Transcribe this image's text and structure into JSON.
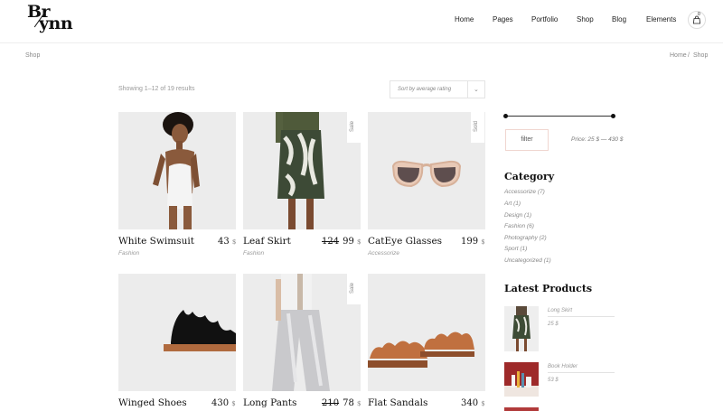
{
  "header": {
    "logo_line1": "Br",
    "logo_line2": "ynn",
    "nav": [
      "Home",
      "Pages",
      "Portfolio",
      "Shop",
      "Blog",
      "Elements"
    ],
    "cart_count": "0"
  },
  "breadcrumb": {
    "page_title": "Shop",
    "trail_home": "Home",
    "trail_sep": "/",
    "trail_current": "Shop"
  },
  "toolbar": {
    "results_text": "Showing 1–12 of 19 results",
    "sort_value": "Sort by average rating"
  },
  "products": [
    {
      "name": "White Swimsuit",
      "category": "Fashion",
      "price": "43",
      "old_price": "",
      "currency": "$",
      "badge": ""
    },
    {
      "name": "Leaf Skirt",
      "category": "Fashion",
      "price": "99",
      "old_price": "124",
      "currency": "$",
      "badge": "Sale"
    },
    {
      "name": "CatEye Glasses",
      "category": "Accessorize",
      "price": "199",
      "old_price": "",
      "currency": "$",
      "badge": "Sold"
    },
    {
      "name": "Winged Shoes",
      "category": "",
      "price": "430",
      "old_price": "",
      "currency": "$",
      "badge": ""
    },
    {
      "name": "Long Pants",
      "category": "",
      "price": "78",
      "old_price": "210",
      "currency": "$",
      "badge": "Sale"
    },
    {
      "name": "Flat Sandals",
      "category": "",
      "price": "340",
      "old_price": "",
      "currency": "$",
      "badge": ""
    }
  ],
  "sidebar": {
    "filter_label": "filter",
    "price_range": "Price: 25 $ — 430 $",
    "category_title": "Category",
    "categories": [
      "Accessorize (7)",
      "Art (1)",
      "Design (1)",
      "Fashion (6)",
      "Photography (2)",
      "Sport (1)",
      "Uncategorized (1)"
    ],
    "latest_title": "Latest Products",
    "latest": [
      {
        "name": "Long Skirt",
        "price": "25 $"
      },
      {
        "name": "Book Holder",
        "price": "53 $"
      }
    ]
  }
}
